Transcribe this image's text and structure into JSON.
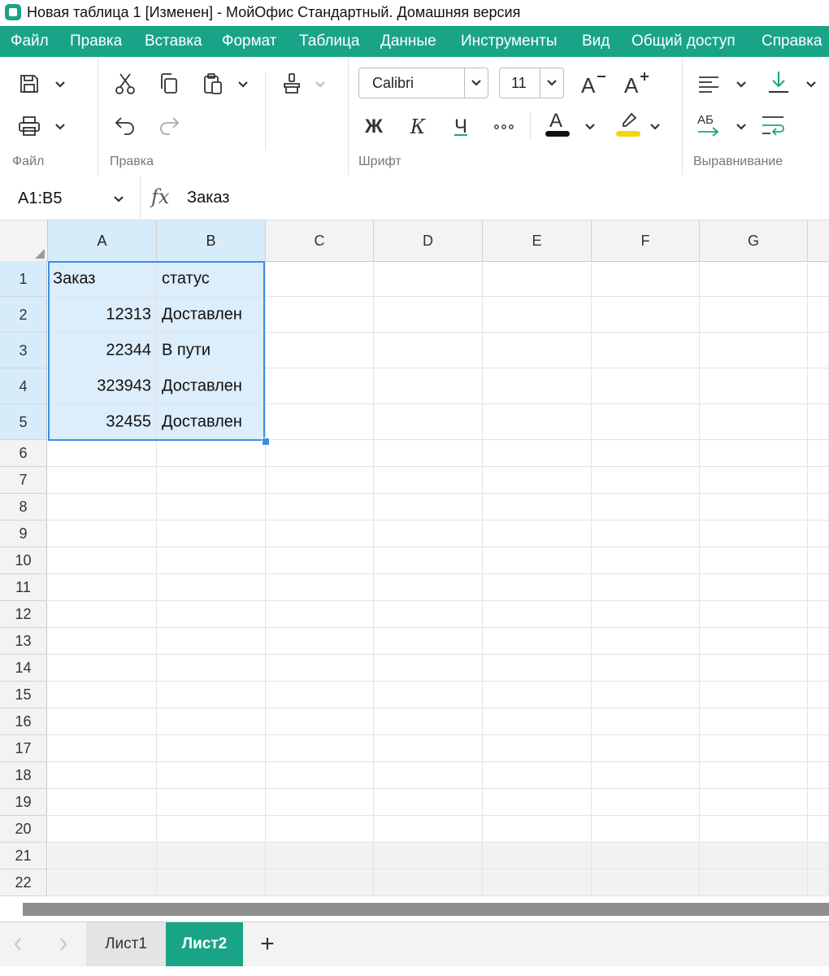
{
  "window": {
    "title": "Новая таблица 1 [Изменен] - МойОфис Стандартный. Домашняя версия"
  },
  "menu": [
    "Файл",
    "Правка",
    "Вставка",
    "Формат",
    "Таблица",
    "Данные",
    "Инструменты",
    "Вид",
    "Общий доступ",
    "Справка"
  ],
  "ribbon": {
    "groups": {
      "file": "Файл",
      "edit": "Правка",
      "font": "Шрифт",
      "align": "Выравнивание"
    },
    "font_name": "Calibri",
    "font_size": "11",
    "bold_label": "Ж",
    "italic_label": "К",
    "underline_label": "Ч",
    "text_dir_label": "АБ",
    "colors": {
      "accent": "#1aa487",
      "font_color": "#111111",
      "highlight": "#f5d50c",
      "selection": "#3a8ee6"
    }
  },
  "formula_bar": {
    "cell_ref": "A1:B5",
    "fx_label": "fx",
    "formula": "Заказ"
  },
  "grid": {
    "columns": [
      "A",
      "B",
      "C",
      "D",
      "E",
      "F",
      "G"
    ],
    "rows": [
      "1",
      "2",
      "3",
      "4",
      "5",
      "6",
      "7",
      "8",
      "9",
      "10",
      "11",
      "12",
      "13",
      "14",
      "15",
      "16",
      "17",
      "18",
      "19",
      "20",
      "21",
      "22"
    ],
    "cells": [
      [
        "Заказ",
        "статус"
      ],
      [
        "12313",
        "Доставлен"
      ],
      [
        "22344",
        "В пути"
      ],
      [
        "323943",
        "Доставлен"
      ],
      [
        "32455",
        "Доставлен"
      ]
    ]
  },
  "sheets": {
    "tabs": [
      "Лист1",
      "Лист2"
    ],
    "active": "Лист2",
    "add_label": "+"
  }
}
